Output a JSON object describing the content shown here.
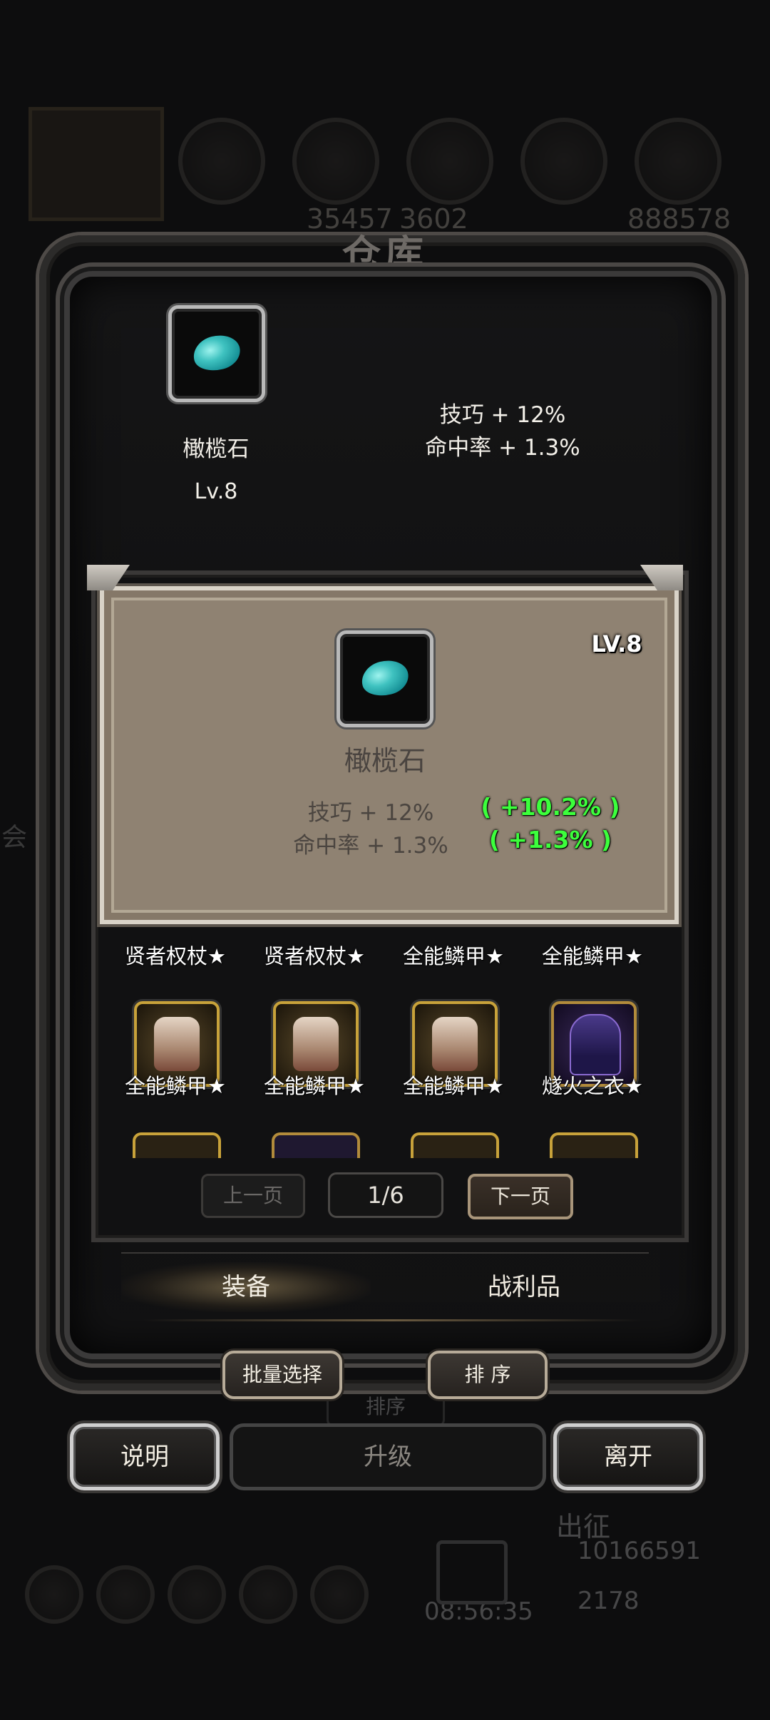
{
  "background": {
    "numbers": [
      "35457",
      "3602",
      "888578"
    ],
    "sort_ghost_label": "排序",
    "expedition_label": "出征",
    "gold_value": "10166591",
    "gem_value": "2178",
    "timer": "08:56:35",
    "side_char": "会"
  },
  "window": {
    "title": "仓库"
  },
  "selected_item": {
    "name": "橄榄石",
    "level": "Lv.8",
    "icon": "teal-gem-icon",
    "stats": [
      "技巧 + 12%",
      "命中率 + 1.3%"
    ]
  },
  "tooltip": {
    "level": "LV.8",
    "name": "橄榄石",
    "stats": [
      {
        "label": "技巧 + 12%",
        "bonus": "( +10.2% )"
      },
      {
        "label": "命中率 + 1.3%",
        "bonus": "( +1.3% )"
      }
    ]
  },
  "grid": {
    "partial_row_labels": [
      "贤者权杖★",
      "贤者权杖★",
      "全能鳞甲★",
      "全能鳞甲★"
    ],
    "row": [
      {
        "label": "全能鳞甲★",
        "icon": "scale-armor-icon"
      },
      {
        "label": "全能鳞甲★",
        "icon": "scale-armor-icon"
      },
      {
        "label": "全能鳞甲★",
        "icon": "scale-armor-icon"
      },
      {
        "label": "燧火之衣★",
        "icon": "purple-robe-icon"
      }
    ]
  },
  "pagination": {
    "prev_label": "上一页",
    "indicator": "1/6",
    "next_label": "下一页"
  },
  "tabs": [
    {
      "label": "装备",
      "active": true
    },
    {
      "label": "战利品",
      "active": false
    }
  ],
  "actions": {
    "batch_select": "批量选择",
    "sort": "排 序",
    "explain": "说明",
    "upgrade": "升级",
    "leave": "离开"
  },
  "colors": {
    "bonus_green": "#3cff3c",
    "card_bg": "#8f8272",
    "gem_teal": "#3fc2c0"
  }
}
